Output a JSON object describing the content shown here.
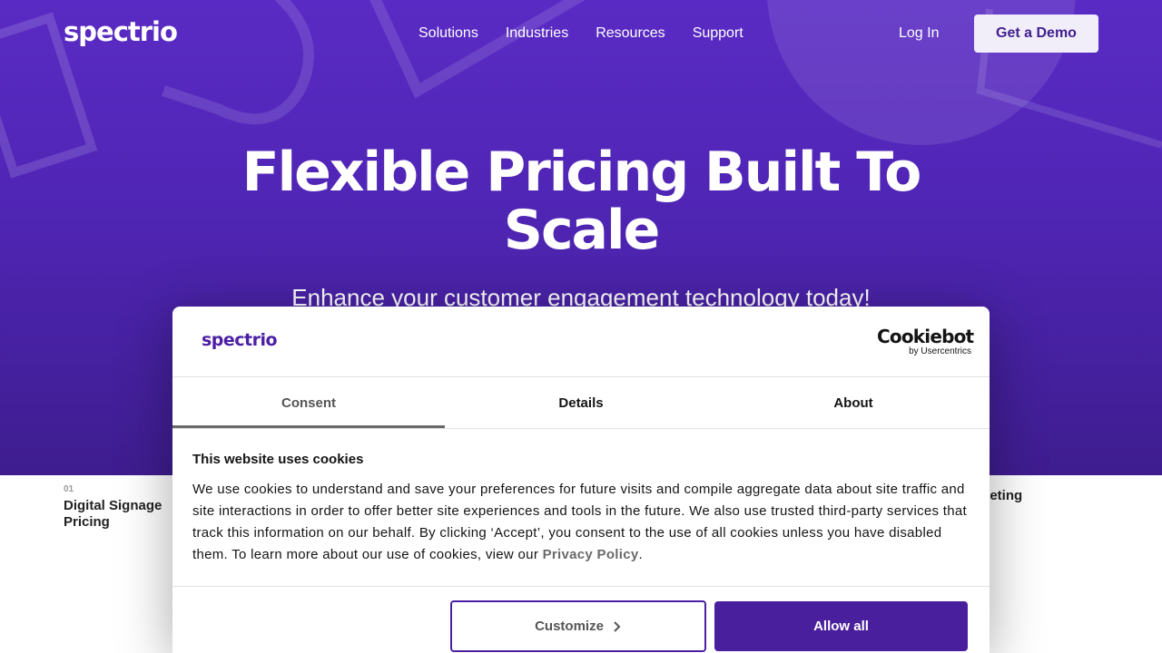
{
  "nav": {
    "logo": "spectrio",
    "links": [
      "Solutions",
      "Industries",
      "Resources",
      "Support"
    ],
    "login": "Log In",
    "demo": "Get a Demo"
  },
  "hero": {
    "title": "Flexible Pricing Built To Scale",
    "subtitle": "Enhance your customer engagement technology today!"
  },
  "pricing_tabs": [
    {
      "num": "01",
      "label": "Digital Signage Pricing"
    },
    {
      "num": "",
      "label": "keting"
    }
  ],
  "cookie_dialog": {
    "brand_logo": "spectrio",
    "provider_logo": "Cookiebot",
    "provider_sub": "by Usercentrics",
    "tabs": [
      "Consent",
      "Details",
      "About"
    ],
    "active_tab": "Consent",
    "heading": "This website uses cookies",
    "body": "We use cookies to understand and save your preferences for future visits and compile aggregate data about site traffic and site interactions in order to offer better site experiences and tools in the future. We also use trusted third-party services that track this information on our behalf. By clicking ‘Accept’, you consent to the use of all cookies unless you have disabled them. To learn more about our use of cookies, view our",
    "link": "Privacy Policy",
    "body_end": ".",
    "customize": "Customize",
    "allow_all": "Allow all"
  },
  "colors": {
    "brand_purple": "#4a1f9e",
    "hero_purple": "#5a2bc4"
  }
}
